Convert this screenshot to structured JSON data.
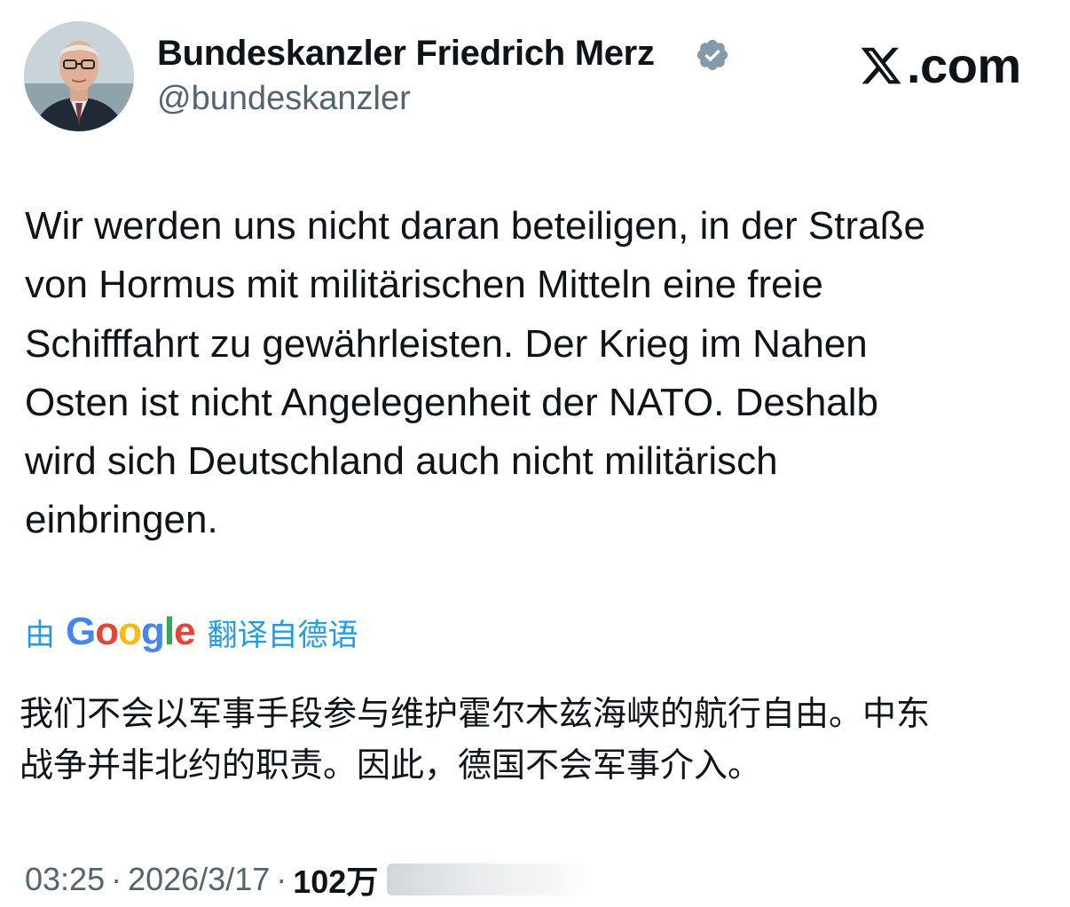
{
  "author": {
    "name": "Bundeskanzler Friedrich Merz",
    "handle": "@bundeskanzler",
    "verified_color": "#829aab"
  },
  "brand": {
    "suffix": ".com",
    "icon": "x-logo-icon"
  },
  "tweet": {
    "lines": [
      "Wir werden uns nicht daran beteiligen, in der Straße",
      "von Hormus mit militärischen Mitteln eine freie",
      "Schifffahrt zu gewährleisten. Der Krieg im Nahen",
      "Osten ist nicht Angelegenheit der NATO. Deshalb",
      "wird sich Deutschland auch nicht militärisch",
      "einbringen."
    ]
  },
  "translation": {
    "prefix": "由",
    "provider": "Google",
    "suffix": "翻译自德语",
    "lines": [
      "我们不会以军事手段参与维护霍尔木兹海峡的航行自由。中东",
      "战争并非北约的职责。因此，德国不会军事介入。"
    ]
  },
  "meta": {
    "time": "03:25",
    "separator": "·",
    "date": "2026/3/17",
    "views": "102万"
  },
  "colors": {
    "link": "#1d9bf0",
    "secondary_text": "#536471",
    "primary_text": "#0f1419"
  }
}
